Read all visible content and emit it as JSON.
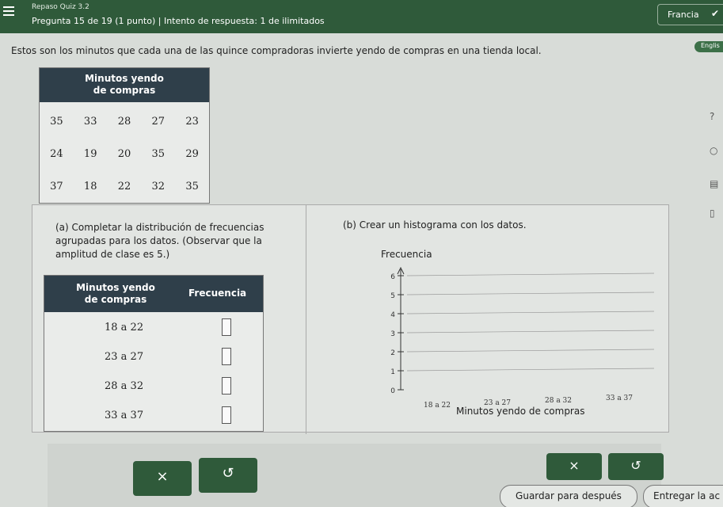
{
  "header": {
    "quiz_name": "Repaso Quiz 3.2",
    "question_info": "Pregunta 15 de 19 (1 punto)  |  Intento de respuesta: 1 de ilimitados",
    "student_name": "Francia"
  },
  "language_badge": "Englis",
  "intro_text": "Estos son los minutos que cada una de las quince compradoras invierte yendo de compras en una tienda local.",
  "data_table": {
    "header": [
      "Minutos yendo",
      "de compras"
    ],
    "rows": [
      [
        "35",
        "33",
        "28",
        "27",
        "23"
      ],
      [
        "24",
        "19",
        "20",
        "35",
        "29"
      ],
      [
        "37",
        "18",
        "22",
        "32",
        "35"
      ]
    ]
  },
  "part_a": {
    "text": "(a) Completar la distribución de frecuencias agrupadas para los datos. (Observar que la amplitud de clase es 5.)",
    "table_header_col1": [
      "Minutos yendo",
      "de compras"
    ],
    "table_header_col2": "Frecuencia",
    "rows": [
      "18 a 22",
      "23 a 27",
      "28 a 32",
      "33 a 37"
    ]
  },
  "part_b": {
    "text": "(b) Crear un histograma con los datos.",
    "y_label": "Frecuencia",
    "x_label": "Minutos yendo de compras",
    "y_ticks": [
      "0",
      "1",
      "2",
      "3",
      "4",
      "5",
      "6"
    ],
    "x_categories": [
      "18 a 22",
      "23 a 27",
      "28 a 32",
      "33 a 37"
    ]
  },
  "buttons": {
    "clear": "×",
    "undo": "↺",
    "save": "Guardar para después",
    "submit": "Entregar la ac"
  }
}
